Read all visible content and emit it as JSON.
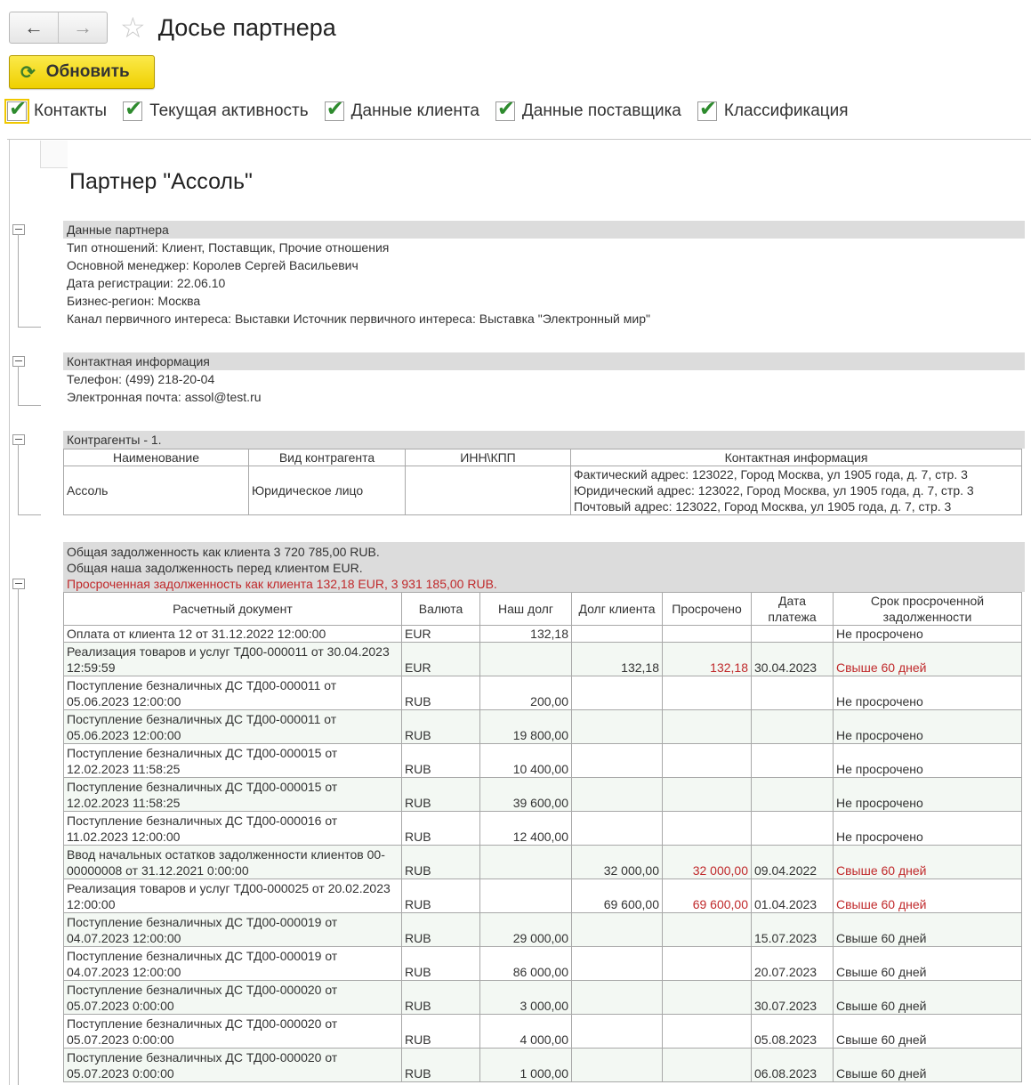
{
  "window": {
    "title": "Досье партнера",
    "back_icon": "←",
    "forward_icon": "→"
  },
  "toolbar": {
    "refresh_label": "Обновить"
  },
  "checks": [
    {
      "label": "Контакты"
    },
    {
      "label": "Текущая активность"
    },
    {
      "label": "Данные клиента"
    },
    {
      "label": "Данные поставщика"
    },
    {
      "label": "Классификация"
    }
  ],
  "report": {
    "partner_title": "Партнер \"Ассоль\"",
    "partner_data": {
      "header": "Данные партнера",
      "lines": [
        "Тип отношений: Клиент, Поставщик, Прочие отношения",
        "Основной менеджер: Королев Сергей Васильевич",
        "Дата регистрации: 22.06.10",
        "Бизнес-регион: Москва",
        "Канал первичного интереса: Выставки  Источник первичного интереса: Выставка \"Электронный мир\""
      ]
    },
    "contacts": {
      "header": "Контактная информация",
      "lines": [
        "Телефон: (499) 218-20-04",
        "Электронная почта: assol@test.ru"
      ]
    },
    "counterparties": {
      "header": "Контрагенты - 1.",
      "columns": [
        "Наименование",
        "Вид контрагента",
        "ИНН\\КПП",
        "Контактная информация"
      ],
      "row": {
        "name": "Ассоль",
        "kind": "Юридическое лицо",
        "inn": "",
        "contact_lines": [
          "Фактический адрес: 123022, Город Москва, ул 1905 года, д. 7, стр. 3",
          "Юридический адрес: 123022, Город Москва, ул 1905 года, д. 7, стр. 3",
          "Почтовый адрес: 123022, Город Москва, ул 1905 года, д. 7, стр. 3"
        ]
      }
    },
    "debt": {
      "summary1": "Общая задолженность как клиента 3 720 785,00 RUB.",
      "summary2": "Общая наша задолженность перед клиентом  EUR.",
      "summary3": "Просроченная задолженность как клиента 132,18 EUR, 3 931 185,00 RUB.",
      "columns": [
        "Расчетный документ",
        "Валюта",
        "Наш долг",
        "Долг клиента",
        "Просрочено",
        "Дата платежа",
        "Срок просроченной задолженности"
      ],
      "rows": [
        {
          "doc": "Оплата от клиента 12 от 31.12.2022 12:00:00",
          "cur": "EUR",
          "our": "132,18",
          "client": "",
          "overdue": "",
          "date": "",
          "term": "Не просрочено",
          "late": false
        },
        {
          "doc": "Реализация товаров и услуг ТД00-000011 от 30.04.2023 12:59:59",
          "cur": "EUR",
          "our": "",
          "client": "132,18",
          "overdue": "132,18",
          "date": "30.04.2023",
          "term": "Свыше 60 дней",
          "late": true
        },
        {
          "doc": "Поступление безналичных ДС ТД00-000011 от 05.06.2023 12:00:00",
          "cur": "RUB",
          "our": "200,00",
          "client": "",
          "overdue": "",
          "date": "",
          "term": "Не просрочено",
          "late": false
        },
        {
          "doc": "Поступление безналичных ДС ТД00-000011 от 05.06.2023 12:00:00",
          "cur": "RUB",
          "our": "19 800,00",
          "client": "",
          "overdue": "",
          "date": "",
          "term": "Не просрочено",
          "late": false
        },
        {
          "doc": "Поступление безналичных ДС ТД00-000015 от 12.02.2023 11:58:25",
          "cur": "RUB",
          "our": "10 400,00",
          "client": "",
          "overdue": "",
          "date": "",
          "term": "Не просрочено",
          "late": false
        },
        {
          "doc": "Поступление безналичных ДС ТД00-000015 от 12.02.2023 11:58:25",
          "cur": "RUB",
          "our": "39 600,00",
          "client": "",
          "overdue": "",
          "date": "",
          "term": "Не просрочено",
          "late": false
        },
        {
          "doc": "Поступление безналичных ДС ТД00-000016 от 11.02.2023 12:00:00",
          "cur": "RUB",
          "our": "12 400,00",
          "client": "",
          "overdue": "",
          "date": "",
          "term": "Не просрочено",
          "late": false
        },
        {
          "doc": "Ввод начальных остатков задолженности клиентов 00-00000008 от 31.12.2021 0:00:00",
          "cur": "RUB",
          "our": "",
          "client": "32 000,00",
          "overdue": "32 000,00",
          "date": "09.04.2022",
          "term": "Свыше 60 дней",
          "late": true
        },
        {
          "doc": "Реализация товаров и услуг ТД00-000025 от 20.02.2023 12:00:00",
          "cur": "RUB",
          "our": "",
          "client": "69 600,00",
          "overdue": "69 600,00",
          "date": "01.04.2023",
          "term": "Свыше 60 дней",
          "late": true
        },
        {
          "doc": "Поступление безналичных ДС ТД00-000019 от 04.07.2023 12:00:00",
          "cur": "RUB",
          "our": "29 000,00",
          "client": "",
          "overdue": "",
          "date": "15.07.2023",
          "term": "Свыше 60 дней",
          "late": false
        },
        {
          "doc": "Поступление безналичных ДС ТД00-000019 от 04.07.2023 12:00:00",
          "cur": "RUB",
          "our": "86 000,00",
          "client": "",
          "overdue": "",
          "date": "20.07.2023",
          "term": "Свыше 60 дней",
          "late": false
        },
        {
          "doc": "Поступление безналичных ДС ТД00-000020 от 05.07.2023 0:00:00",
          "cur": "RUB",
          "our": "3 000,00",
          "client": "",
          "overdue": "",
          "date": "30.07.2023",
          "term": "Свыше 60 дней",
          "late": false
        },
        {
          "doc": "Поступление безналичных ДС ТД00-000020 от 05.07.2023 0:00:00",
          "cur": "RUB",
          "our": "4 000,00",
          "client": "",
          "overdue": "",
          "date": "05.08.2023",
          "term": "Свыше 60 дней",
          "late": false
        },
        {
          "doc": "Поступление безналичных ДС ТД00-000020 от 05.07.2023 0:00:00",
          "cur": "RUB",
          "our": "1 000,00",
          "client": "",
          "overdue": "",
          "date": "06.08.2023",
          "term": "Свыше 60 дней",
          "late": false
        }
      ]
    }
  },
  "colors": {
    "accent": "#f0c800",
    "check": "#2e8b2e",
    "overdue": "#c0292b"
  }
}
